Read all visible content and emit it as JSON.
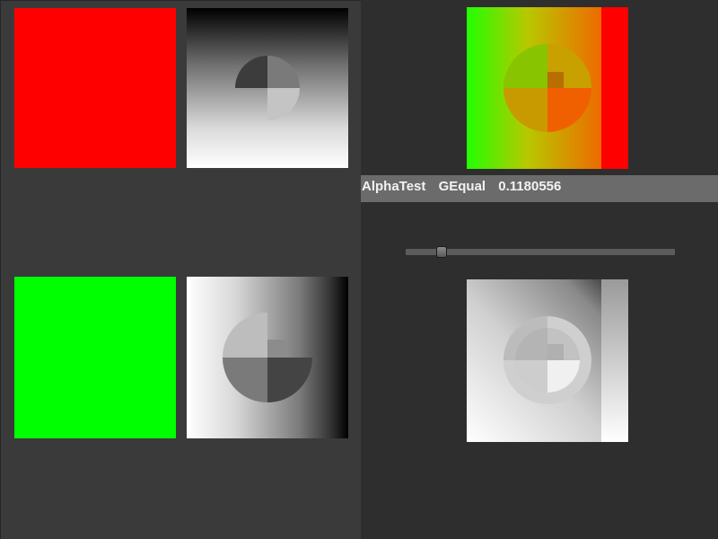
{
  "info_bar": {
    "mode": "AlphaTest",
    "compare": "GEqual",
    "value": "0.1180556"
  },
  "slider": {
    "value": 0.1180556
  },
  "tiles": {
    "red_swatch": {
      "color": "#ff0000"
    },
    "green_swatch": {
      "color": "#00ff00"
    }
  },
  "colors": {
    "left_panel_bg": "#3a3a3a",
    "right_panel_bg": "#2e2e2e",
    "info_bar_bg": "#6b6b6b",
    "slider_track": "#5c5c5c"
  }
}
